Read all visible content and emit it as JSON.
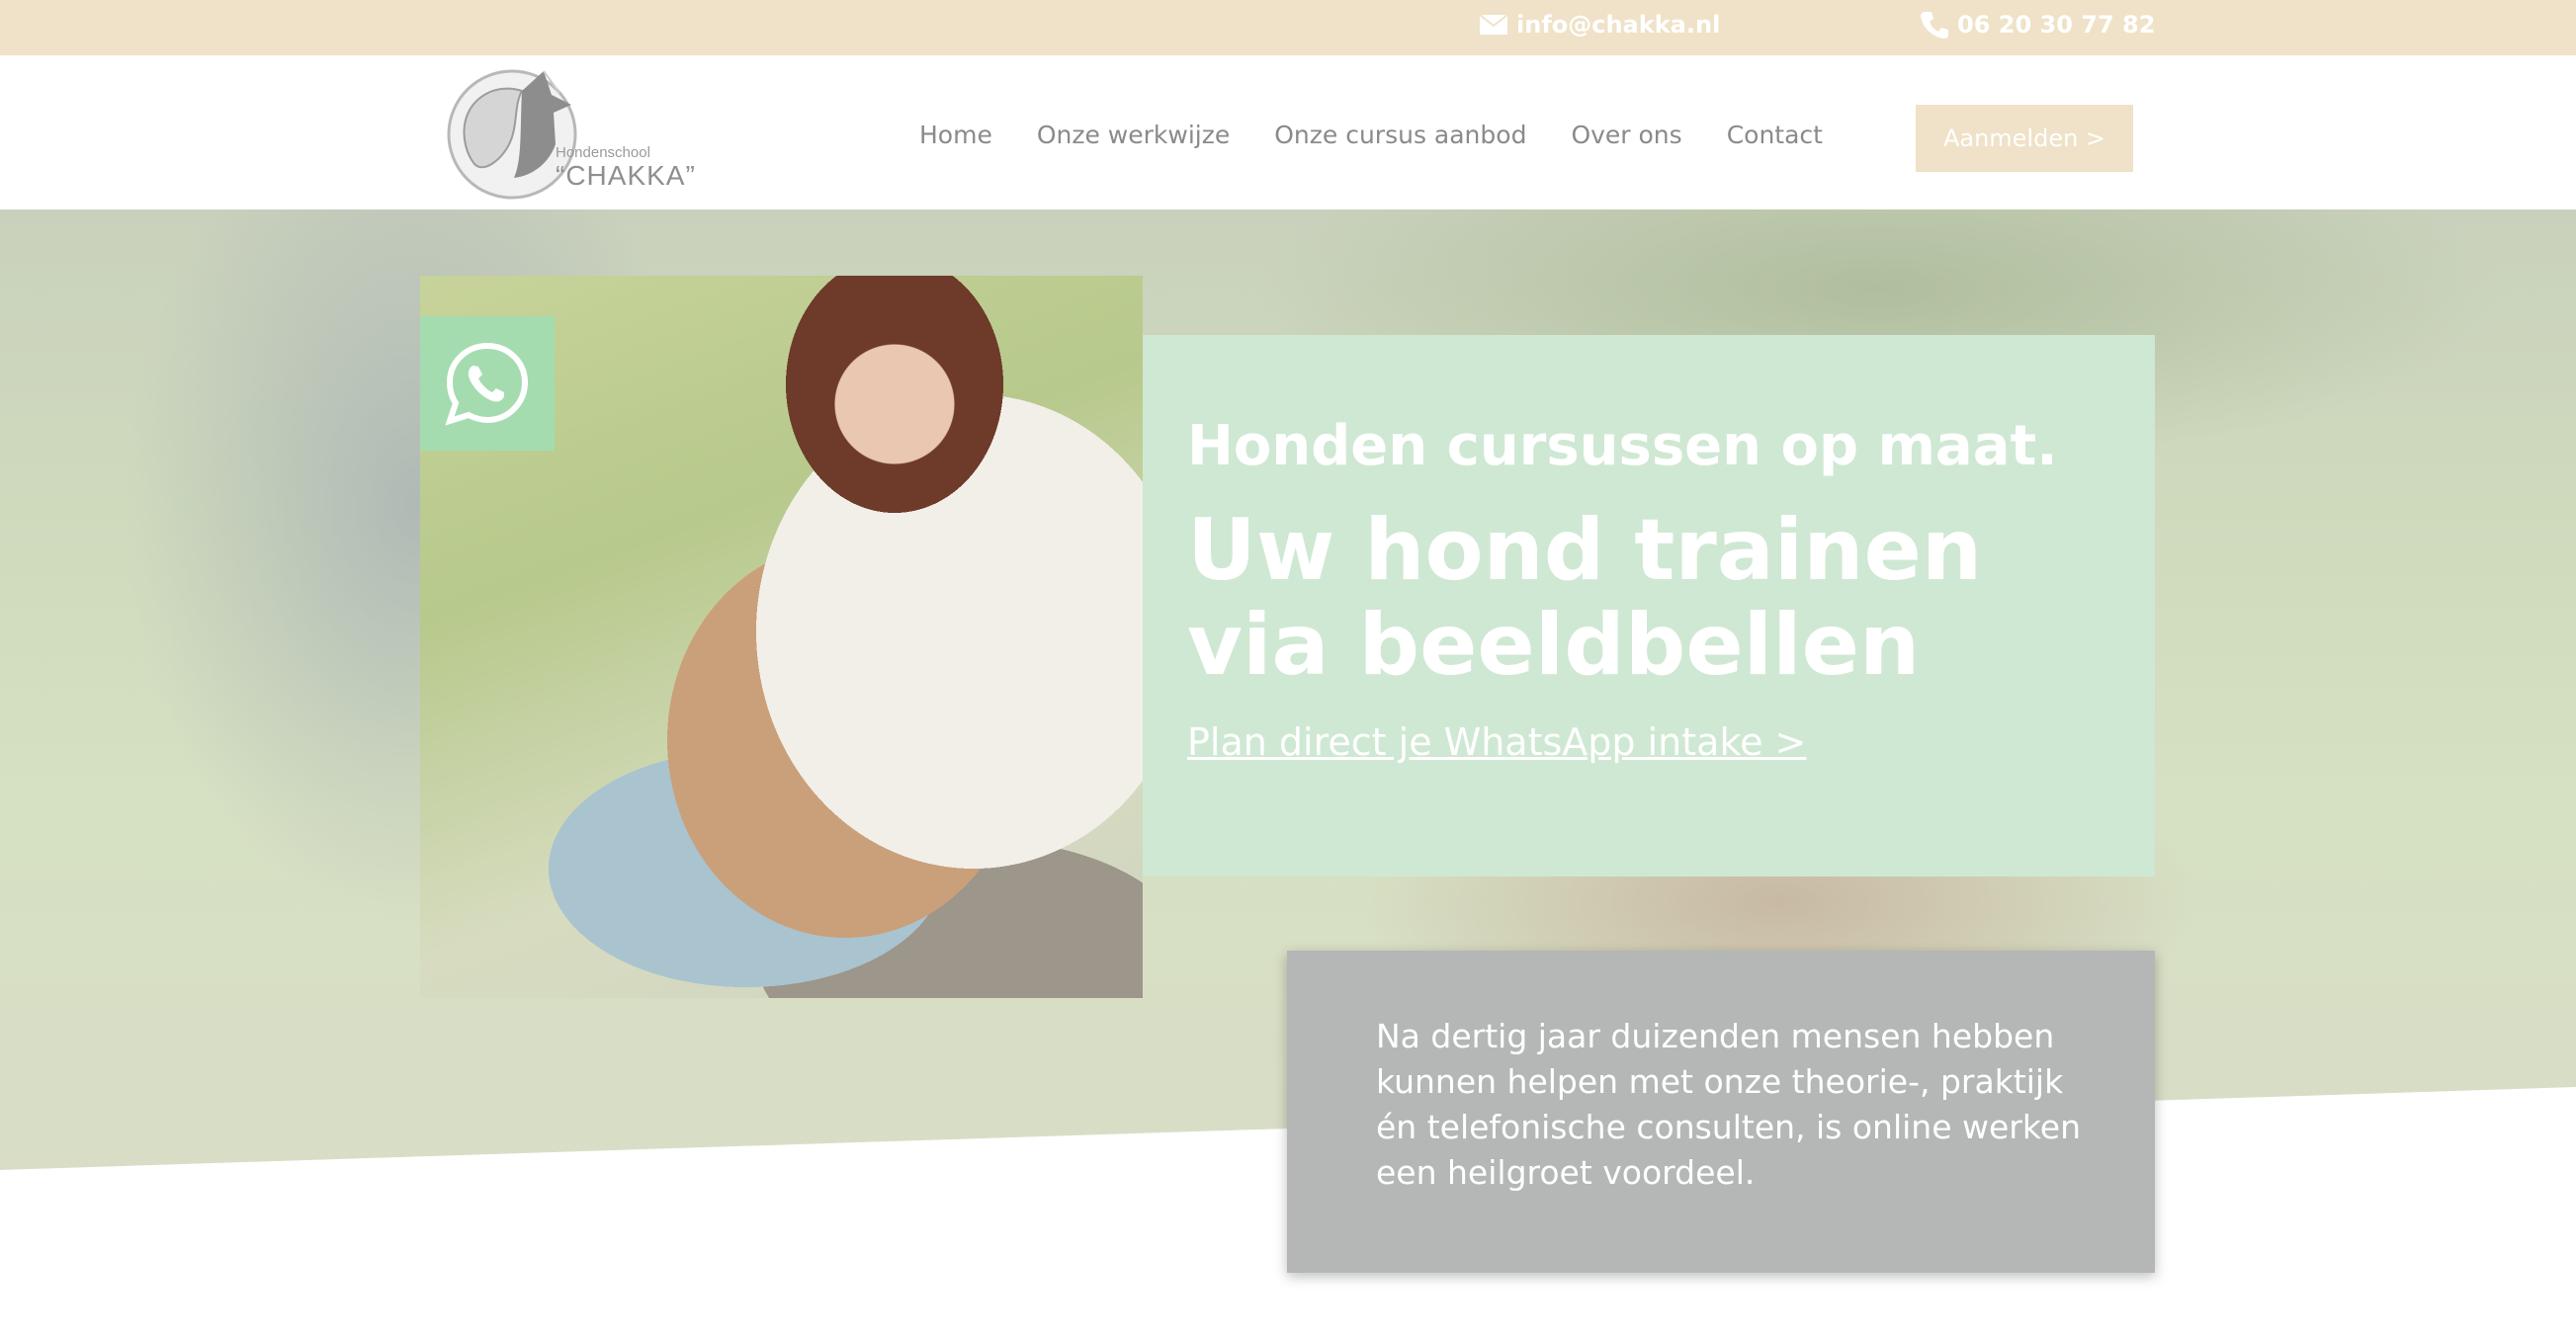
{
  "topbar": {
    "email": "info@chakka.nl",
    "phone": "06 20 30 77 82",
    "icons": {
      "email": "envelope-icon",
      "phone": "phone-icon"
    },
    "background": "#efe2c8"
  },
  "header": {
    "logo": {
      "small_text": "Hondenschool",
      "brand_text": "“CHAKKA”"
    },
    "nav": [
      "Home",
      "Onze werkwijze",
      "Onze cursus aanbod",
      "Over ons",
      "Contact"
    ],
    "signup_label": "Aanmelden >",
    "signup_color": "#efe2c8"
  },
  "hero": {
    "tagline": "Honden cursussen op maat.",
    "headline": "Uw hond trainen via beeldbellen",
    "cta": "Plan direct je WhatsApp intake >",
    "whatsapp_icon": "whatsapp-icon",
    "green_color": "#cfe8d3",
    "badge_color": "#a4dcb0"
  },
  "info": {
    "text": "Na dertig jaar duizenden mensen hebben kunnen helpen met onze theorie-, praktijk én telefonische consulten, is online werken een heilgroet voordeel.",
    "background": "#b4b7b6"
  }
}
